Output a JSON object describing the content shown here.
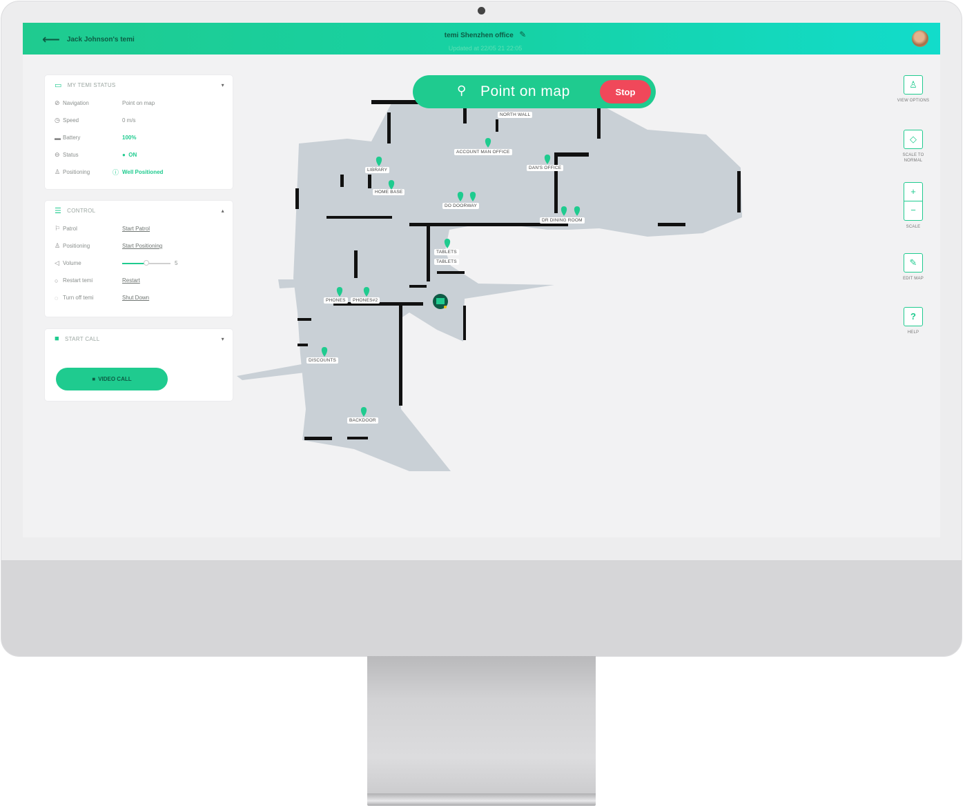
{
  "header": {
    "back_label": "Jack Johnson's temi",
    "title": "temi Shenzhen office",
    "subtitle": "Updated at 22/05 21 22:05"
  },
  "status_panel": {
    "title": "MY TEMI STATUS",
    "rows": [
      {
        "icon": "navigation-icon",
        "label": "Navigation",
        "value": "Point on map"
      },
      {
        "icon": "speed-icon",
        "label": "Speed",
        "value": "0 m/s"
      },
      {
        "icon": "battery-icon",
        "label": "Battery",
        "value": "100%"
      },
      {
        "icon": "status-icon",
        "label": "Status",
        "value": "ON"
      },
      {
        "icon": "positioning-icon",
        "label": "Positioning",
        "value": "Well Positioned"
      }
    ]
  },
  "control_panel": {
    "title": "CONTROL",
    "patrol_label": "Patrol",
    "patrol_action": "Start Patrol",
    "positioning_label": "Positioning",
    "positioning_action": "Start Positioning",
    "volume_label": "Volume",
    "volume_value": "5",
    "volume_level": 0.5,
    "restart_label": "Restart temi",
    "restart_action": "Restart",
    "turnoff_label": "Turn off temi",
    "turnoff_action": "Shut Down"
  },
  "call_panel": {
    "title": "START CALL",
    "video_button": "VIDEO CALL"
  },
  "point_on_map": {
    "label": "Point on map",
    "stop_label": "Stop"
  },
  "map_labels": {
    "north_wall": "NORTH WALL",
    "account_man_office": "ACCOUNT MAN OFFICE",
    "dans_office": "DAN'S OFFICE",
    "library": "LIBRARY",
    "home_base": "HOME BASE",
    "do_doorway": "DO DOORWAY",
    "dr_dining_room": "DR DINING ROOM",
    "tablets_1": "TABLETS",
    "tablets_2": "TABLETS",
    "phones": "PHONES",
    "phones_2": "PHONES#2",
    "discounts": "DISCOUNTS",
    "backdoor": "BACKDOOR"
  },
  "toolbar": {
    "view_options": "VIEW OPTIONS",
    "scale_to_normal_1": "SCALE TO",
    "scale_to_normal_2": "NORMAL",
    "zoom_in": "+",
    "zoom_out": "−",
    "scale": "SCALE",
    "edit_map": "EDIT MAP",
    "help": "HELP"
  },
  "colors": {
    "accent": "#1fcb8f",
    "stop": "#f0485a",
    "map_floor": "#c9d0d6"
  }
}
